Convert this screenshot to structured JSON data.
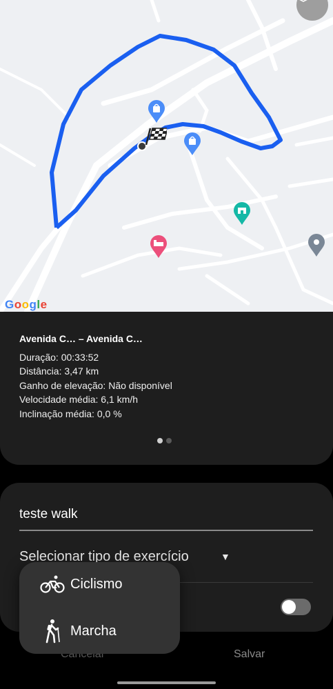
{
  "map": {
    "layers_icon": "layers-icon",
    "logo_text": "Google",
    "logo_colors": [
      "#4285F4",
      "#EA4335",
      "#FBBC05",
      "#4285F4",
      "#34A853",
      "#EA4335"
    ],
    "route_color": "#1a5ff0"
  },
  "info": {
    "route_title": "Avenida C… – Avenida C…",
    "stats": [
      "Duração: 00:33:52",
      "Distância: 3,47 km",
      "Ganho de elevação: Não disponível",
      "Velocidade média: 6,1 km/h",
      "Inclinação média: 0,0 %"
    ],
    "page_count": 2,
    "active_page": 1
  },
  "form": {
    "name_value": "teste walk",
    "select_label": "Selecionar tipo de exercício",
    "toggle_on": false
  },
  "buttons": {
    "cancel": "Cancelar",
    "save": "Salvar"
  },
  "popup": {
    "items": [
      {
        "label": "Ciclismo",
        "icon": "bicycle-icon"
      },
      {
        "label": "Marcha",
        "icon": "hiking-icon"
      }
    ]
  }
}
